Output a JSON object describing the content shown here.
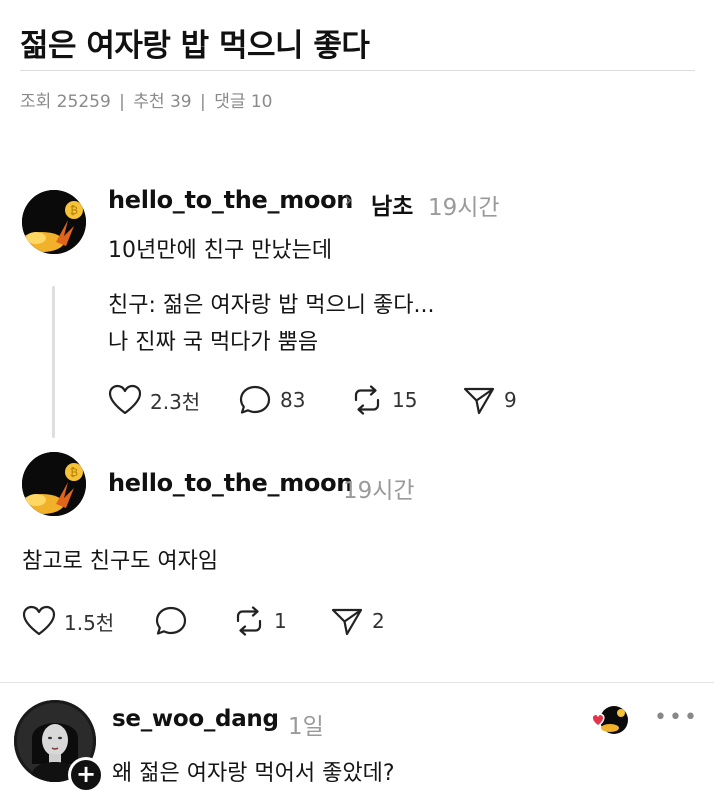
{
  "post": {
    "title": "젊은 여자랑 밥 먹으니 좋다",
    "stats": {
      "views": "조회 25259",
      "recommends": "추천 39",
      "comments": "댓글 10",
      "separator": "|"
    }
  },
  "thread1": {
    "username": "hello_to_the_moon",
    "reply_target": "남초",
    "time": "19시간",
    "line1": "10년만에 친구 만났는데",
    "quote_line1": "친구: 젊은 여자랑 밥 먹으니 좋다...",
    "quote_line2": "나 진짜 국 먹다가 뿜음",
    "likes": "2.3천",
    "comments": "83",
    "reposts": "15",
    "shares": "9"
  },
  "thread2": {
    "username": "hello_to_the_moon",
    "time": "19시간",
    "text": "참고로 친구도 여자임",
    "likes": "1.5천",
    "comments": "",
    "reposts": "1",
    "shares": "2"
  },
  "thread3": {
    "username": "se_woo_dang",
    "time": "1일",
    "text": "왜 젊은 여자랑 먹어서 좋았데?",
    "more": "•••"
  },
  "icons": {
    "like": "heart-icon",
    "comment": "comment-bubble-icon",
    "repost": "repost-icon",
    "share": "send-icon",
    "follow": "plus-icon"
  },
  "colors": {
    "accent_orange": "#f08a1c",
    "heart_red": "#e5334a",
    "muted_text": "#9a9a9a"
  }
}
